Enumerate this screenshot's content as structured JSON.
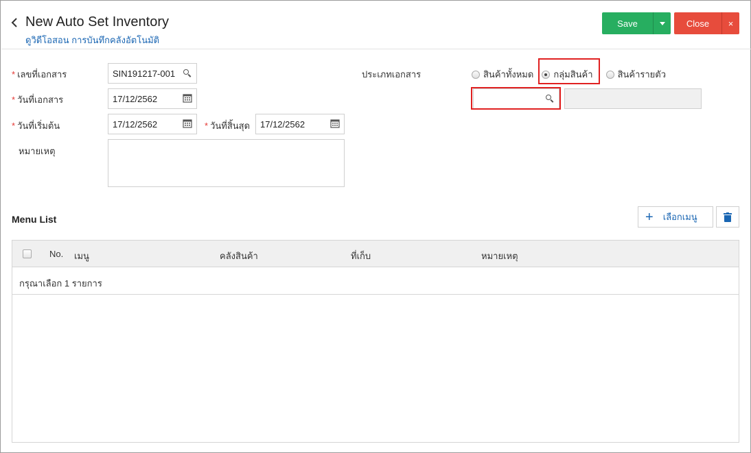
{
  "header": {
    "title": "New Auto Set Inventory",
    "subtitle": "ดูวิดีโอสอน การบันทึกคลังอัตโนมัติ",
    "save_label": "Save",
    "close_label": "Close",
    "close_x": "×"
  },
  "form": {
    "doc_no": {
      "label": "เลขที่เอกสาร",
      "value": "SIN191217-001"
    },
    "doc_date": {
      "label": "วันที่เอกสาร",
      "value": "17/12/2562"
    },
    "start_date": {
      "label": "วันที่เริ่มต้น",
      "value": "17/12/2562"
    },
    "end_date": {
      "label": "วันที่สิ้นสุด",
      "value": "17/12/2562"
    },
    "remark": {
      "label": "หมายเหตุ",
      "value": ""
    },
    "doc_type": {
      "label": "ประเภทเอกสาร",
      "options": [
        "สินค้าทั้งหมด",
        "กลุ่มสินค้า",
        "สินค้ารายตัว"
      ],
      "selected": "กลุ่มสินค้า"
    },
    "group_search": {
      "value": ""
    },
    "group_name": {
      "value": ""
    }
  },
  "menu_list": {
    "title": "Menu List",
    "select_menu_label": "เลือกเมนู",
    "columns": [
      "No.",
      "เมนู",
      "คลังสินค้า",
      "ที่เก็บ",
      "หมายเหตุ"
    ],
    "empty_text": "กรุณาเลือก 1 รายการ"
  },
  "colors": {
    "save": "#27ae60",
    "close": "#e74c3c",
    "link": "#1a66b3",
    "required": "#e53935",
    "highlight": "#e02020"
  },
  "icons": [
    "chevron-left-icon",
    "caret-down-icon",
    "close-icon",
    "search-icon",
    "calendar-icon",
    "plus-icon",
    "trash-icon"
  ]
}
